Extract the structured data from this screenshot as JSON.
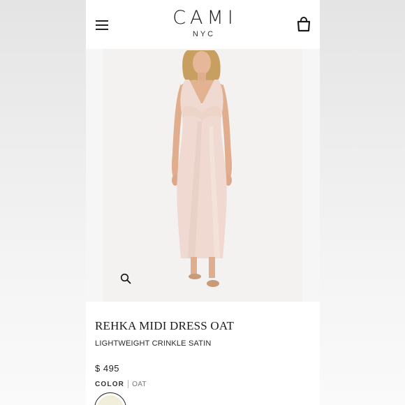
{
  "header": {
    "brand": "CAMI",
    "brand_sub": "NYC",
    "menu_icon": "hamburger-menu-icon",
    "cart_icon": "shopping-bag-icon"
  },
  "gallery": {
    "zoom_icon": "magnifier-icon"
  },
  "product": {
    "name": "REHKA MIDI DRESS OAT",
    "subtitle": "LIGHTWEIGHT CRINKLE SATIN",
    "price": "$ 495",
    "color_label": "COLOR",
    "color_value": "OAT",
    "swatch_color": "#f1efdc"
  },
  "colors": {
    "dress": "#efd9d0",
    "skin": "#e3b292",
    "hair": "#c7a061",
    "text": "#1b1b1b"
  }
}
